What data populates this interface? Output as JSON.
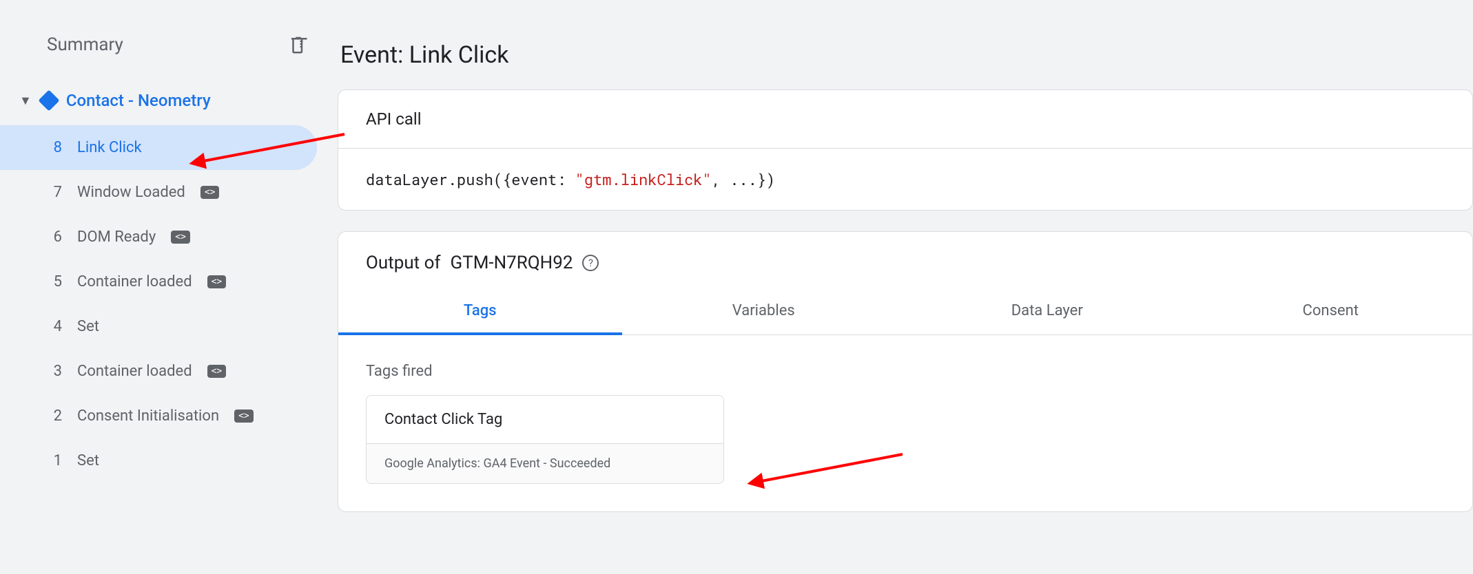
{
  "sidebar": {
    "summary_label": "Summary",
    "page_title": "Contact - Neometry",
    "events": [
      {
        "num": "8",
        "label": "Link Click",
        "has_badge": false,
        "active": true
      },
      {
        "num": "7",
        "label": "Window Loaded",
        "has_badge": true,
        "active": false
      },
      {
        "num": "6",
        "label": "DOM Ready",
        "has_badge": true,
        "active": false
      },
      {
        "num": "5",
        "label": "Container loaded",
        "has_badge": true,
        "active": false
      },
      {
        "num": "4",
        "label": "Set",
        "has_badge": false,
        "active": false
      },
      {
        "num": "3",
        "label": "Container loaded",
        "has_badge": true,
        "active": false
      },
      {
        "num": "2",
        "label": "Consent Initialisation",
        "has_badge": true,
        "active": false
      },
      {
        "num": "1",
        "label": "Set",
        "has_badge": false,
        "active": false
      }
    ]
  },
  "main": {
    "title": "Event: Link Click",
    "api_card": {
      "heading": "API call",
      "code_prefix": "dataLayer.push({event: ",
      "code_string": "\"gtm.linkClick\"",
      "code_suffix": ", ...})"
    },
    "output_card": {
      "heading_prefix": "Output of ",
      "container_id": "GTM-N7RQH92",
      "tabs": [
        "Tags",
        "Variables",
        "Data Layer",
        "Consent"
      ],
      "active_tab": 0,
      "section_label": "Tags fired",
      "fired_tag": {
        "name": "Contact Click Tag",
        "detail": "Google Analytics: GA4 Event - Succeeded"
      }
    }
  }
}
